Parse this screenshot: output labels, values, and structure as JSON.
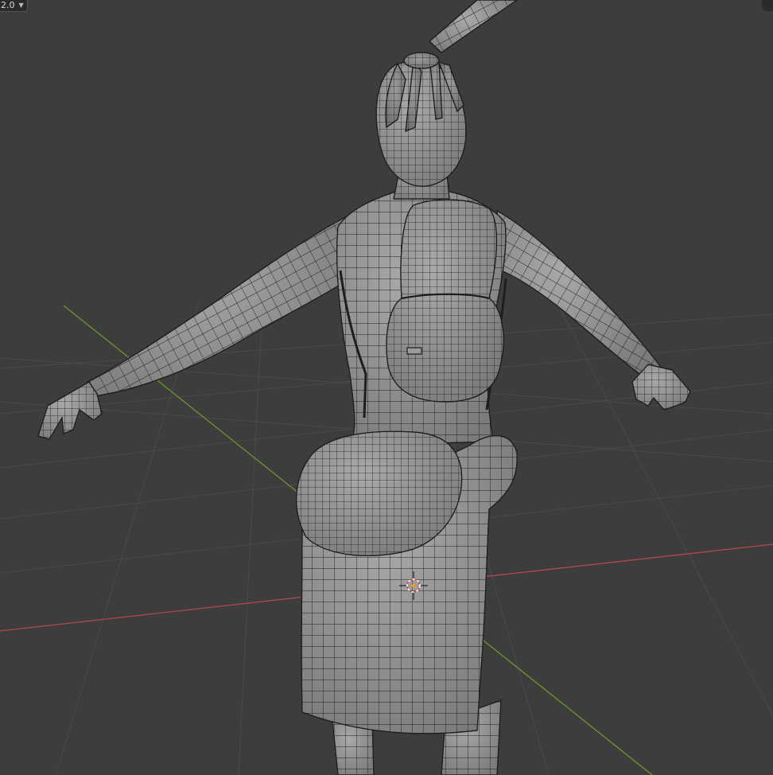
{
  "viewport": {
    "zoom_value": "2.0",
    "zoom_dropdown_icon": "chevron-down-icon",
    "corner_icon": "navigate-gizmo-icon",
    "background_color": "#3d3d3d",
    "grid_color": "#4a4a4a",
    "x_axis_color": "#b0484e",
    "y_axis_color": "#6e9632",
    "mesh_fill_color": "#8e8e8e",
    "wire_color": "#1e1e1e",
    "object_name": "character-mesh"
  }
}
